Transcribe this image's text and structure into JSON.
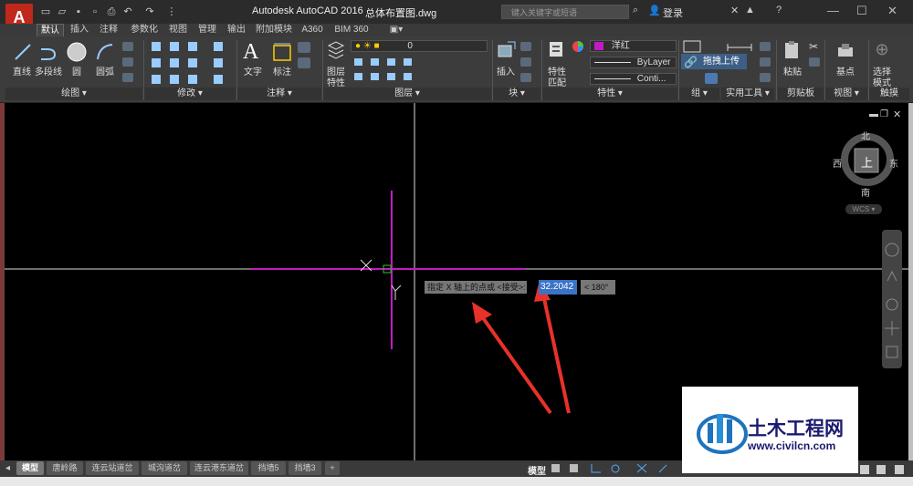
{
  "title_bar": {
    "app_button": "A",
    "app_title": "Autodesk AutoCAD 2016",
    "file_name": "总体布置图.dwg",
    "search_placeholder": "键入关键字或短语",
    "login": "登录",
    "help": "?",
    "minimize": "—",
    "maximize": "☐",
    "close": "✕"
  },
  "ribbon_tabs": [
    "默认",
    "插入",
    "注释",
    "参数化",
    "视图",
    "管理",
    "输出",
    "附加模块",
    "A360",
    "BIM 360"
  ],
  "ribbon": {
    "draw": {
      "line": "直线",
      "polyline": "多段线",
      "circle": "圆",
      "arc": "圆弧",
      "panel": "绘图 ▾"
    },
    "modify": {
      "panel": "修改 ▾"
    },
    "annotation": {
      "text": "文字",
      "dimension": "标注",
      "panel": "注释 ▾"
    },
    "layers": {
      "layer_props": "图层",
      "layer_props2": "特性",
      "layer_name": "0",
      "panel": "图层 ▾"
    },
    "block": {
      "insert": "插入",
      "panel": "块 ▾"
    },
    "properties": {
      "match": "特性",
      "match2": "匹配",
      "color": "洋红",
      "linetype": "ByLayer",
      "lineweight": "Conti...",
      "panel": "特性 ▾"
    },
    "group": {
      "panel": "组 ▾"
    },
    "utilities": {
      "panel": "实用工具 ▾"
    },
    "clipboard": {
      "paste": "粘贴",
      "panel": "剪贴板"
    },
    "view": {
      "base": "基点",
      "panel": "视图 ▾"
    },
    "touch": {
      "select_mode": "选择",
      "select_mode2": "模式",
      "panel": "触摸"
    }
  },
  "tooltip": "拖拽上传",
  "viewcube": {
    "north": "北",
    "south": "南",
    "east": "东",
    "west": "西",
    "top": "上",
    "wcs": "WCS ▾"
  },
  "command": {
    "prompt": "指定 X 轴上的点或 <接受>:",
    "value": "32.2042",
    "angle": "< 180°"
  },
  "layout_tabs": [
    "模型",
    "唐岭路",
    "连云站道岔",
    "城沟道岔",
    "连云港东道岔",
    "挡墙5",
    "挡墙3",
    "+"
  ],
  "status_bar": {
    "model": "模型"
  },
  "watermark": {
    "name": "土木工程网",
    "url": "www.civilcn.com"
  },
  "colors": {
    "magenta": "#c21ac2",
    "arrow": "#e8312a",
    "value_highlight": "#3b73c7",
    "canvas": "#000000"
  },
  "icons": [
    "app-menu-icon",
    "new-icon",
    "open-icon",
    "save-icon",
    "print-icon",
    "undo-icon",
    "redo-icon",
    "search-icon",
    "user-icon",
    "exchange-icon",
    "help-icon",
    "line-icon",
    "polyline-icon",
    "circle-icon",
    "arc-icon",
    "move-icon",
    "rotate-icon",
    "trim-icon",
    "text-icon",
    "dimension-icon",
    "layer-icon",
    "insert-icon",
    "match-properties-icon",
    "paste-icon",
    "base-point-icon",
    "select-mode-icon",
    "navigation-bar-icon",
    "viewcube-icon"
  ]
}
